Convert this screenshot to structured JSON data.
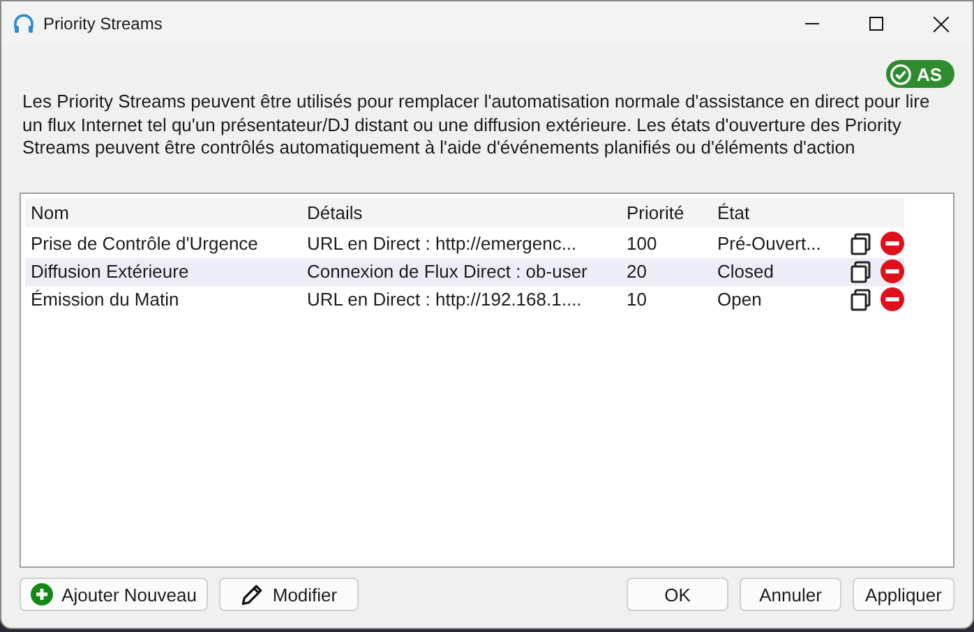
{
  "window": {
    "title": "Priority Streams"
  },
  "badge": {
    "label": "AS",
    "on": true
  },
  "description": "Les Priority Streams peuvent être utilisés pour remplacer l'automatisation normale d'assistance en direct pour lire un flux Internet tel qu'un présentateur/DJ distant ou une diffusion extérieure. Les états d'ouverture des Priority Streams peuvent être contrôlés automatiquement à l'aide d'événements planifiés ou d'éléments d'action",
  "table": {
    "columns": [
      "Nom",
      "Détails",
      "Priorité",
      "État"
    ],
    "rows": [
      {
        "name": "Prise de Contrôle d'Urgence",
        "details": "URL en Direct : http://emergenc...",
        "priority": "100",
        "state": "Pré-Ouvert...",
        "selected": false
      },
      {
        "name": "Diffusion Extérieure",
        "details": "Connexion de Flux Direct : ob-user",
        "priority": "20",
        "state": "Closed",
        "selected": true
      },
      {
        "name": "Émission du Matin",
        "details": "URL en Direct : http://192.168.1....",
        "priority": "10",
        "state": "Open",
        "selected": false
      }
    ]
  },
  "left_buttons": [
    {
      "label": "Ajouter Nouveau",
      "kind": "add"
    },
    {
      "label": "Modifier",
      "kind": "edit"
    }
  ],
  "right_buttons": [
    "OK",
    "Annuler",
    "Appliquer"
  ]
}
